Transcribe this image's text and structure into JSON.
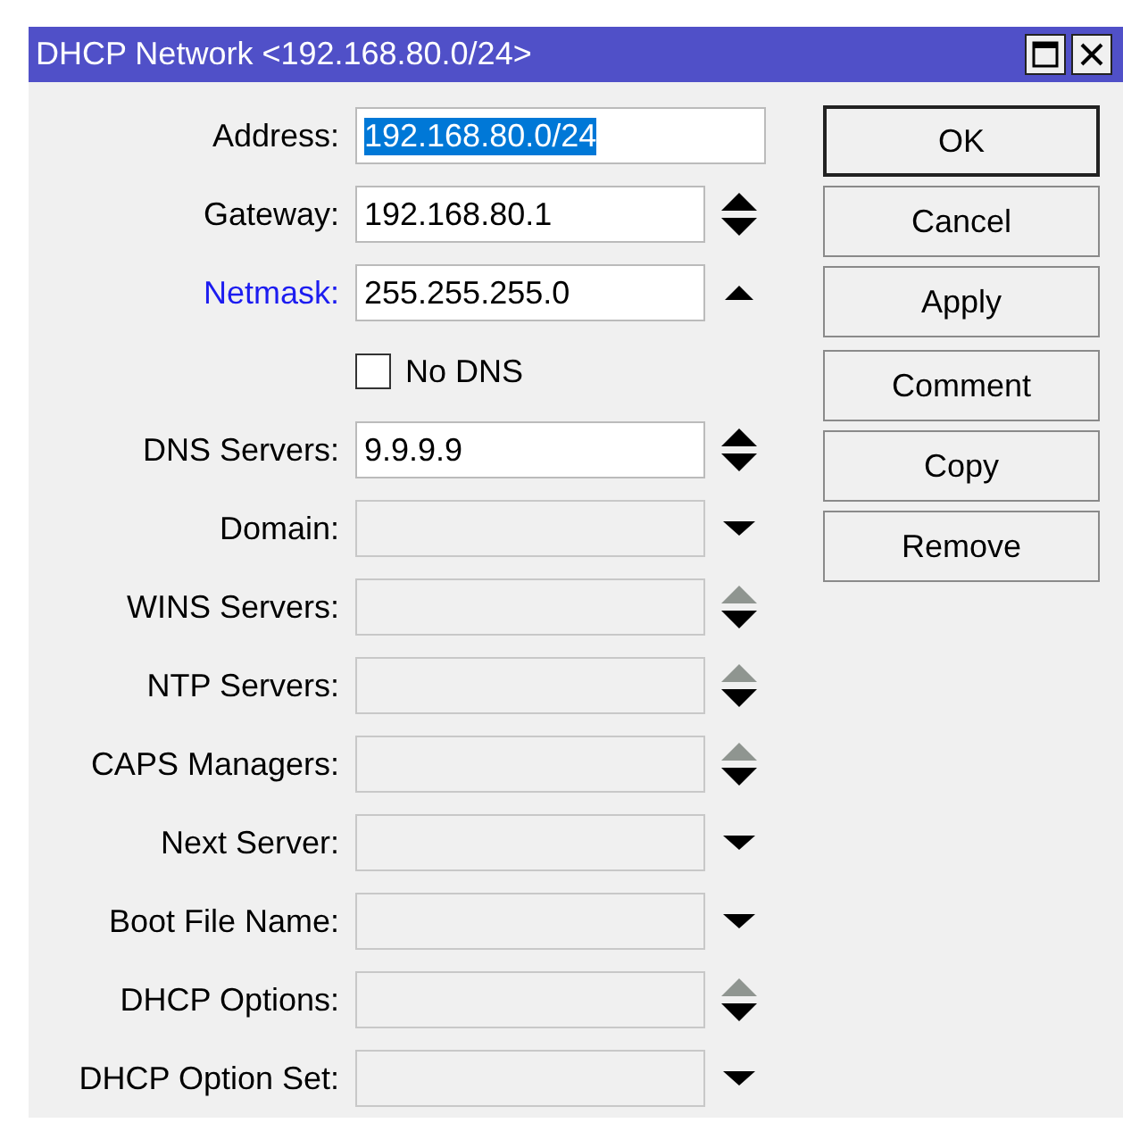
{
  "window": {
    "title": "DHCP Network <192.168.80.0/24>"
  },
  "form": [
    {
      "kind": "field",
      "label": "Address:",
      "label_highlighted": false,
      "value": "192.168.80.0/24",
      "value_selected": true,
      "disabled": false,
      "wide": true,
      "has_up": false,
      "has_down": false
    },
    {
      "kind": "field",
      "label": "Gateway:",
      "label_highlighted": false,
      "value": "192.168.80.1",
      "value_selected": false,
      "disabled": false,
      "wide": false,
      "has_up": true,
      "has_down": true,
      "up_disabled": false
    },
    {
      "kind": "field",
      "label": "Netmask:",
      "label_highlighted": true,
      "value": "255.255.255.0",
      "value_selected": false,
      "disabled": false,
      "wide": false,
      "has_up": true,
      "has_down": false,
      "up_disabled": false
    },
    {
      "kind": "checkbox",
      "label": "No DNS",
      "checked": false
    },
    {
      "kind": "field",
      "label": "DNS Servers:",
      "label_highlighted": false,
      "value": "9.9.9.9",
      "value_selected": false,
      "disabled": false,
      "wide": false,
      "has_up": true,
      "has_down": true,
      "up_disabled": false
    },
    {
      "kind": "field",
      "label": "Domain:",
      "label_highlighted": false,
      "disabled": true,
      "wide": false,
      "has_up": false,
      "has_down": true
    },
    {
      "kind": "field",
      "label": "WINS Servers:",
      "label_highlighted": false,
      "disabled": true,
      "wide": false,
      "has_up": true,
      "has_down": true,
      "up_disabled": true
    },
    {
      "kind": "field",
      "label": "NTP Servers:",
      "label_highlighted": false,
      "disabled": true,
      "wide": false,
      "has_up": true,
      "has_down": true,
      "up_disabled": true
    },
    {
      "kind": "field",
      "label": "CAPS Managers:",
      "label_highlighted": false,
      "disabled": true,
      "wide": false,
      "has_up": true,
      "has_down": true,
      "up_disabled": true
    },
    {
      "kind": "field",
      "label": "Next Server:",
      "label_highlighted": false,
      "disabled": true,
      "wide": false,
      "has_up": false,
      "has_down": true
    },
    {
      "kind": "field",
      "label": "Boot File Name:",
      "label_highlighted": false,
      "disabled": true,
      "wide": false,
      "has_up": false,
      "has_down": true
    },
    {
      "kind": "field",
      "label": "DHCP Options:",
      "label_highlighted": false,
      "disabled": true,
      "wide": false,
      "has_up": true,
      "has_down": true,
      "up_disabled": true
    },
    {
      "kind": "field",
      "label": "DHCP Option Set:",
      "label_highlighted": false,
      "disabled": true,
      "wide": false,
      "has_up": false,
      "has_down": true
    }
  ],
  "button_groups": [
    {
      "buttons": [
        {
          "label": "OK",
          "default": true
        },
        {
          "label": "Cancel",
          "default": false
        },
        {
          "label": "Apply",
          "default": false
        }
      ]
    },
    {
      "buttons": [
        {
          "label": "Comment",
          "default": false
        },
        {
          "label": "Copy",
          "default": false
        },
        {
          "label": "Remove",
          "default": false
        }
      ]
    }
  ]
}
